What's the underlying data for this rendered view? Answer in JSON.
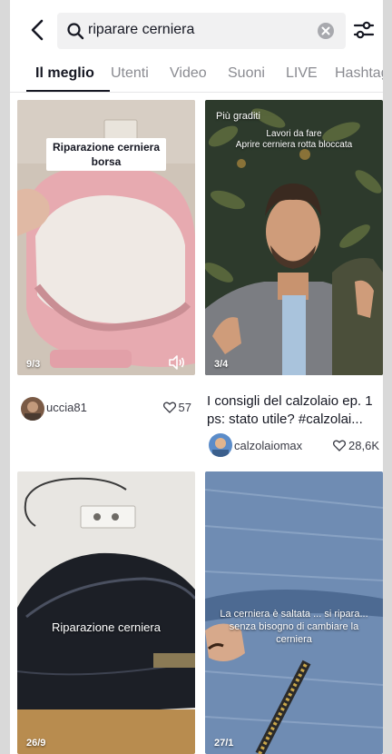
{
  "search": {
    "query": "riparare cerniera"
  },
  "tabs": [
    {
      "label": "Il meglio"
    },
    {
      "label": "Utenti"
    },
    {
      "label": "Video"
    },
    {
      "label": "Suoni"
    },
    {
      "label": "LIVE"
    },
    {
      "label": "Hashtag"
    }
  ],
  "icons": {
    "back": "chevron-left-icon",
    "search": "search-icon",
    "clear": "clear-icon",
    "filter": "sliders-icon",
    "like": "heart-outline-icon",
    "sound": "volume-icon"
  },
  "cards": [
    {
      "caption": "Riparazione cerniera borsa",
      "count": "9/3",
      "username": "uccia81",
      "likes": "57"
    },
    {
      "badge": "Più graditi",
      "overlay": "Lavori da fare\nAprire cerniera rotta bloccata",
      "count": "3/4",
      "title": "I consigli del calzolaio ep. 1 ps: stato utile? #calzolai...",
      "username": "calzolaiomax",
      "likes": "28,6K"
    },
    {
      "overlay": "Riparazione cerniera",
      "count": "26/9"
    },
    {
      "overlay": "La cerniera è saltata ... si ripara... senza bisogno di cambiare la cerniera",
      "count": "27/1"
    }
  ],
  "colors": {
    "accent": "#161823",
    "muted": "#8a8b91",
    "search_bg": "#f1f1f2"
  }
}
